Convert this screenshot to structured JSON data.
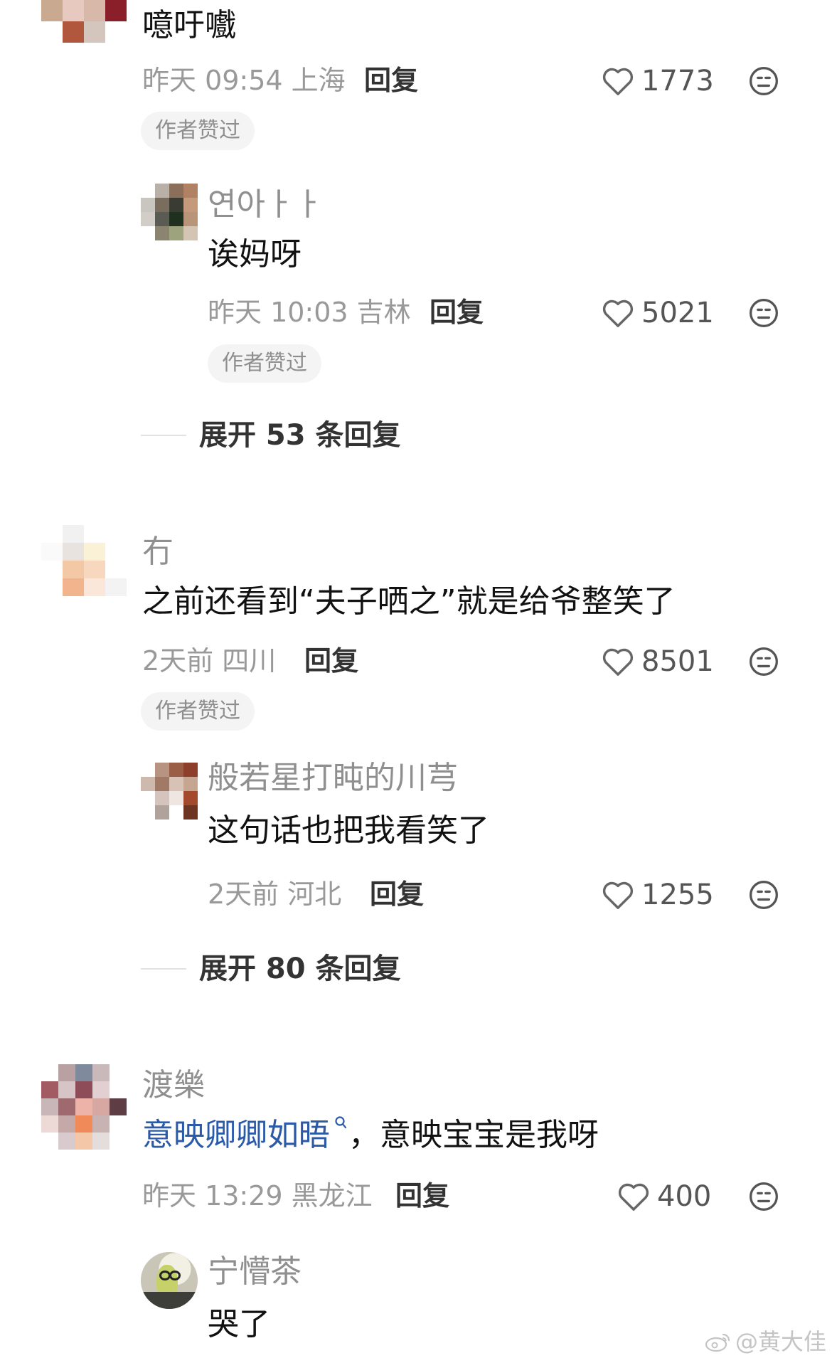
{
  "comments": [
    {
      "content": "噫吁嚱",
      "meta": "昨天 09:54 上海",
      "reply_label": "回复",
      "likes": "1773",
      "badge": "作者赞过",
      "subreply": {
        "username": "연아ㅏㅏ",
        "content": "诶妈呀",
        "meta": "昨天 10:03 吉林",
        "reply_label": "回复",
        "likes": "5021",
        "badge": "作者赞过"
      },
      "expand": "展开 53 条回复"
    },
    {
      "username": "冇",
      "content": "之前还看到“夫子哂之”就是给爷整笑了",
      "meta": "2天前 四川",
      "reply_label": "回复",
      "likes": "8501",
      "badge": "作者赞过",
      "subreply": {
        "username": "般若星打盹的川芎",
        "content": "这句话也把我看笑了",
        "meta": "2天前 河北",
        "reply_label": "回复",
        "likes": "1255"
      },
      "expand": "展开 80 条回复"
    },
    {
      "username": "渡樂",
      "link_text": "意映卿卿如晤",
      "content_rest": "，意映宝宝是我呀",
      "meta": "昨天 13:29 黑龙江",
      "reply_label": "回复",
      "likes": "400",
      "subreply": {
        "username": "宁懵茶",
        "content": "哭了"
      }
    }
  ],
  "watermark": "@黄大佳",
  "icons": {
    "like": "heart-outline-icon",
    "emoji": "face-emoji-icon",
    "search": "search-icon",
    "weibo": "weibo-logo-icon"
  },
  "colors": {
    "link": "#2b5aa8",
    "meta": "#999999",
    "username": "#8f8f8f",
    "badge_bg": "#f4f4f4"
  }
}
